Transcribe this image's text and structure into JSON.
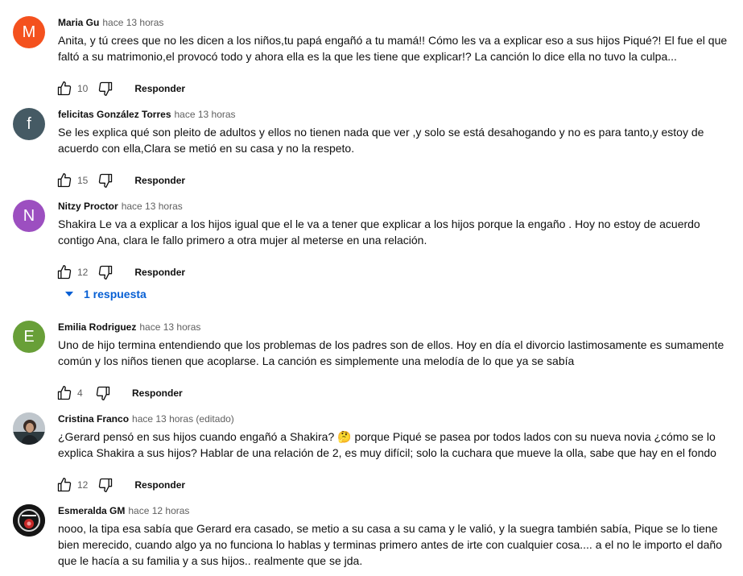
{
  "comments": [
    {
      "author": "Maria Gu",
      "time": "hace 13 horas",
      "initial": "M",
      "avatar_color": "#f4511e",
      "text": "Anita, y tú crees que no les dicen a los niños,tu papá engañó a tu mamá!! Cómo les va a explicar eso a sus hijos Piqué?! El fue el que faltó a su matrimonio,el provocó todo y ahora ella es la que les tiene que explicar!? La canción lo dice ella no tuvo la culpa...",
      "likes": "10",
      "reply_label": "Responder"
    },
    {
      "author": "felicitas González Torres",
      "time": "hace 13 horas",
      "initial": "f",
      "avatar_color": "#455a64",
      "text": "Se les explica qué son pleito de adultos y ellos no tienen nada que ver ,y solo se está desahogando y no es para tanto,y estoy de acuerdo con ella,Clara se metió en su casa y no la respeto.",
      "likes": "15",
      "reply_label": "Responder"
    },
    {
      "author": "Nitzy Proctor",
      "time": "hace 13 horas",
      "initial": "N",
      "avatar_color": "#9c4fc0",
      "text": "Shakira Le va a explicar a los hijos igual que el le va a tener que explicar a los hijos porque la engaño . Hoy no estoy de acuerdo contigo Ana, clara le fallo primero a otra mujer al meterse en una relación.",
      "likes": "12",
      "reply_label": "Responder",
      "replies_label": "1 respuesta"
    },
    {
      "author": "Emilia Rodriguez",
      "time": "hace 13 horas",
      "initial": "E",
      "avatar_color": "#689f38",
      "text": "Uno de hijo termina entendiendo que los problemas de los padres son de ellos. Hoy en día el divorcio lastimosamente es sumamente común y los niños tienen que acoplarse. La canción es simplemente una melodía de lo que ya se sabía",
      "likes": "4",
      "reply_label": "Responder"
    },
    {
      "author": "Cristina Franco",
      "time": "hace 13 horas (editado)",
      "text_before_emoji": "¿Gerard pensó en sus hijos cuando engañó a Shakira? ",
      "emoji": "🤔",
      "text_after_emoji": " porque Piqué se pasea por todos lados con su nueva novia ¿cómo se lo explica Shakira a sus hijos? Hablar de una relación de 2, es muy difícil; solo la cuchara que mueve la olla, sabe que hay en el fondo",
      "likes": "12",
      "reply_label": "Responder"
    },
    {
      "author": "Esmeralda GM",
      "time": "hace 12 horas",
      "text": "nooo, la tipa esa sabía que Gerard era casado, se metio a su casa a su cama y le valió, y la suegra también sabía, Pique se lo tiene bien merecido, cuando algo ya no funciona lo hablas y terminas primero antes de irte con cualquier cosa.... a el no le importo el daño que le hacía a su familia y a sus hijos.. realmente que se jda."
    }
  ],
  "icons": {
    "like": "thumb-up-icon",
    "dislike": "thumb-down-icon",
    "expand": "caret-down-icon"
  },
  "colors": {
    "link": "#065fd4",
    "secondary_text": "#606060"
  }
}
